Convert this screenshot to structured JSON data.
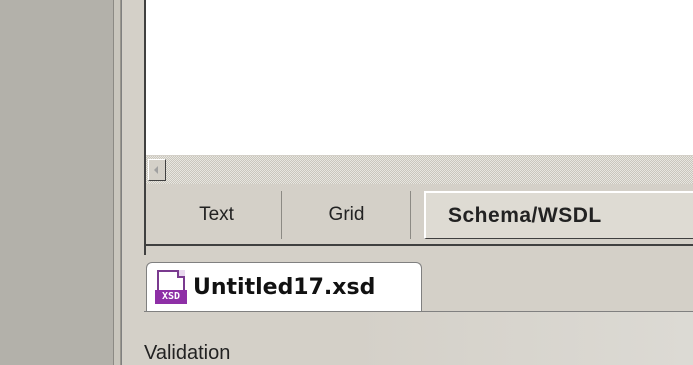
{
  "editor": {
    "view_tabs": [
      {
        "label": "Text",
        "active": false
      },
      {
        "label": "Grid",
        "active": false
      },
      {
        "label": "Schema/WSDL",
        "active": true
      }
    ]
  },
  "document_tabs": [
    {
      "label": "Untitled17.xsd",
      "icon": "xsd-file-icon",
      "icon_text": "XSD",
      "active": true
    }
  ],
  "bottom_panel": {
    "title": "Validation"
  },
  "colors": {
    "xsd_icon_accent": "#8e2fa6",
    "window_background": "#d4d0c8"
  }
}
